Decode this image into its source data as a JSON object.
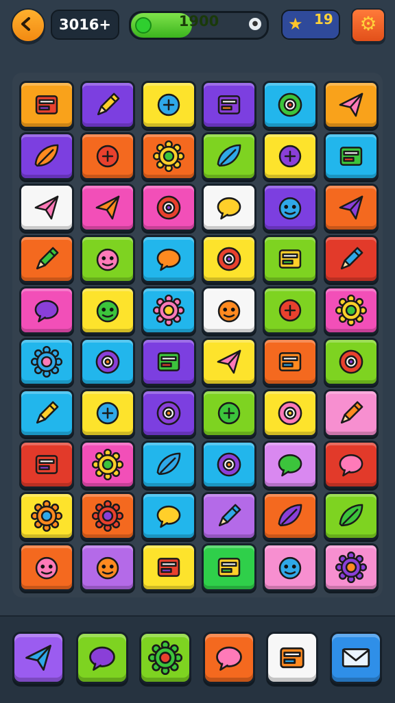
{
  "hud": {
    "score": "3016+",
    "progress_value": "1900",
    "progress_fraction": 0.45,
    "stars": "19",
    "icons": {
      "back": "back-arrow-icon",
      "star": "star-icon",
      "settings": "gear-icon"
    }
  },
  "board": {
    "rows": 10,
    "cols": 6,
    "tiles": [
      {
        "color": "#f9a21b",
        "icon": "gift-box-icon"
      },
      {
        "color": "#7c3fe0",
        "icon": "crayon-icon"
      },
      {
        "color": "#fde32c",
        "icon": "hand-icon"
      },
      {
        "color": "#7c3fe0",
        "icon": "book-icon"
      },
      {
        "color": "#22b6ec",
        "icon": "orbit-icon"
      },
      {
        "color": "#f9a21b",
        "icon": "paper-plane-icon"
      },
      {
        "color": "#7c3fe0",
        "icon": "fish-icon"
      },
      {
        "color": "#f4691f",
        "icon": "robot-icon"
      },
      {
        "color": "#f4691f",
        "icon": "gear-icon"
      },
      {
        "color": "#7ed321",
        "icon": "leaf-icon"
      },
      {
        "color": "#fde32c",
        "icon": "phone-icon"
      },
      {
        "color": "#22b6ec",
        "icon": "document-icon"
      },
      {
        "color": "#f7f7f7",
        "icon": "rocket-icon"
      },
      {
        "color": "#f24fb8",
        "icon": "cheese-icon"
      },
      {
        "color": "#f24fb8",
        "icon": "glasses-icon"
      },
      {
        "color": "#f7f7f7",
        "icon": "shoe-icon"
      },
      {
        "color": "#7c3fe0",
        "icon": "peas-icon"
      },
      {
        "color": "#f4691f",
        "icon": "swords-icon"
      },
      {
        "color": "#f4691f",
        "icon": "ruler-icon"
      },
      {
        "color": "#7ed321",
        "icon": "lollipop-icon"
      },
      {
        "color": "#22b6ec",
        "icon": "crown-icon"
      },
      {
        "color": "#fde32c",
        "icon": "compass-icon"
      },
      {
        "color": "#7ed321",
        "icon": "window-icon"
      },
      {
        "color": "#e23a2a",
        "icon": "pencil-icon"
      },
      {
        "color": "#f24fb8",
        "icon": "cap-icon"
      },
      {
        "color": "#fde32c",
        "icon": "apple-icon"
      },
      {
        "color": "#22b6ec",
        "icon": "sun-icon"
      },
      {
        "color": "#f7f7f7",
        "icon": "capsule-icon"
      },
      {
        "color": "#7ed321",
        "icon": "bulb-icon"
      },
      {
        "color": "#f24fb8",
        "icon": "star-badge-icon"
      },
      {
        "color": "#22b6ec",
        "icon": "sun-icon"
      },
      {
        "color": "#22b6ec",
        "icon": "bag-icon"
      },
      {
        "color": "#7c3fe0",
        "icon": "ticket-icon"
      },
      {
        "color": "#fde32c",
        "icon": "crossed-tools-icon"
      },
      {
        "color": "#f4691f",
        "icon": "stamp-icon"
      },
      {
        "color": "#7ed321",
        "icon": "ring-icon"
      },
      {
        "color": "#22b6ec",
        "icon": "carrot-icon"
      },
      {
        "color": "#fde32c",
        "icon": "chain-icon"
      },
      {
        "color": "#7c3fe0",
        "icon": "camera-icon"
      },
      {
        "color": "#7ed321",
        "icon": "funnel-icon"
      },
      {
        "color": "#fde32c",
        "icon": "clock-icon"
      },
      {
        "color": "#f78fd0",
        "icon": "pen-icon"
      },
      {
        "color": "#e23a2a",
        "icon": "battery-icon"
      },
      {
        "color": "#f24fb8",
        "icon": "gear-icon"
      },
      {
        "color": "#22b6ec",
        "icon": "leaf-icon"
      },
      {
        "color": "#22b6ec",
        "icon": "target-icon"
      },
      {
        "color": "#d988f0",
        "icon": "sled-icon"
      },
      {
        "color": "#e23a2a",
        "icon": "whistle-icon"
      },
      {
        "color": "#fde32c",
        "icon": "sunburst-icon"
      },
      {
        "color": "#f4691f",
        "icon": "gear-icon"
      },
      {
        "color": "#22b6ec",
        "icon": "speech-icon"
      },
      {
        "color": "#b46ae8",
        "icon": "pen-target-icon"
      },
      {
        "color": "#f4691f",
        "icon": "feather-icon"
      },
      {
        "color": "#7ed321",
        "icon": "leaf-icon"
      },
      {
        "color": "#f4691f",
        "icon": "monster-icon"
      },
      {
        "color": "#b46ae8",
        "icon": "bell-icon"
      },
      {
        "color": "#fde32c",
        "icon": "toaster-icon"
      },
      {
        "color": "#2fcf4a",
        "icon": "briefcase-icon"
      },
      {
        "color": "#f78fd0",
        "icon": "blob-icon"
      },
      {
        "color": "#f78fd0",
        "icon": "sun-face-icon"
      }
    ]
  },
  "bottom_bar": {
    "buttons": [
      {
        "color": "#9b5cf0",
        "icon": "arrow-cursor-icon"
      },
      {
        "color": "#7ed321",
        "icon": "chat-bubble-icon"
      },
      {
        "color": "#7ed321",
        "icon": "sun-face-icon"
      },
      {
        "color": "#f4691f",
        "icon": "shell-icon"
      },
      {
        "color": "#f7f7f7",
        "icon": "calendar-icon"
      },
      {
        "color": "#2f8fe8",
        "icon": "mail-icon"
      }
    ]
  }
}
